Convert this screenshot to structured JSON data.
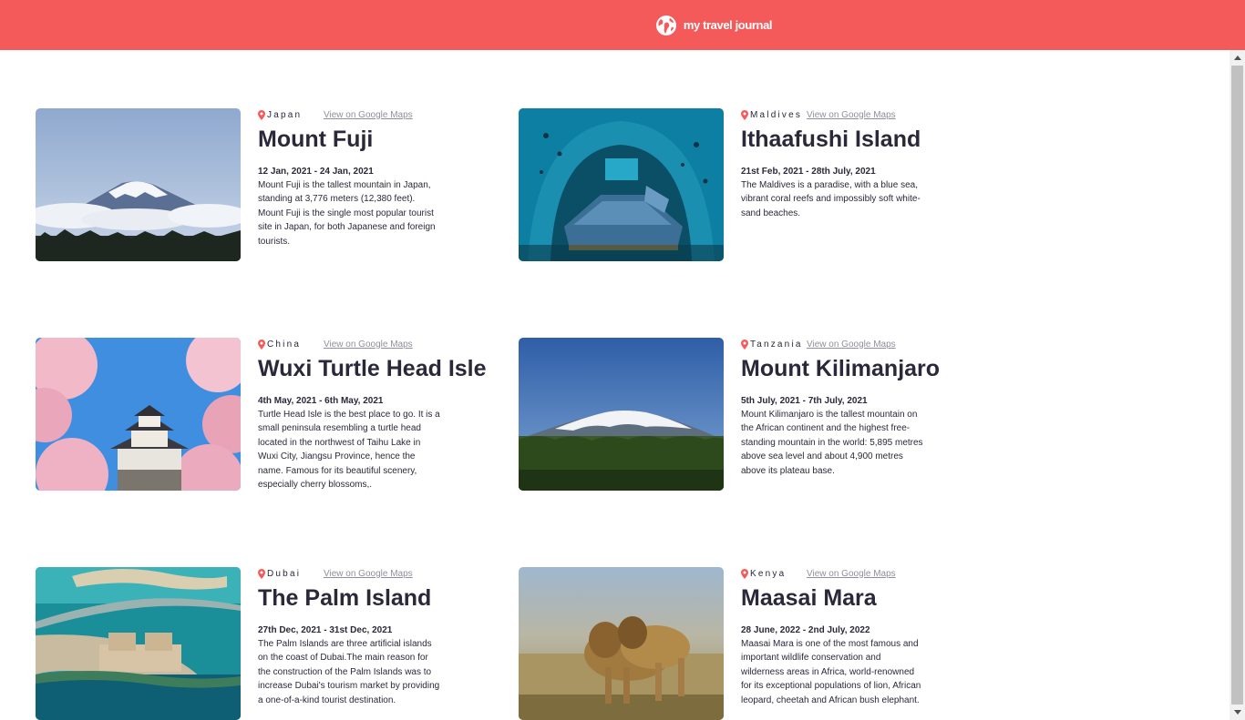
{
  "header": {
    "title": "my travel journal",
    "icon": "globe-icon",
    "background": "#f55a5a"
  },
  "entries": [
    {
      "country": "Japan",
      "maps_label": "View on Google Maps",
      "title": "Mount Fuji",
      "dates": "12 Jan, 2021 - 24 Jan, 2021",
      "description": "Mount Fuji is the tallest mountain in Japan, standing at 3,776 meters (12,380 feet). Mount Fuji is the single most popular tourist site in Japan, for both Japanese and foreign tourists."
    },
    {
      "country": "Maldives",
      "maps_label": "View on Google Maps",
      "title": "Ithaafushi Island",
      "dates": "21st Feb, 2021 - 28th July, 2021",
      "description": "The Maldives is a paradise, with a blue sea, vibrant coral reefs and impossibly soft white-sand beaches."
    },
    {
      "country": "China",
      "maps_label": "View on Google Maps",
      "title": "Wuxi Turtle Head Isle",
      "dates": "4th May, 2021 - 6th May, 2021",
      "description": "Turtle Head Isle is the best place to go. It is a small peninsula resembling a turtle head located in the northwest of Taihu Lake in Wuxi City, Jiangsu Province, hence the name. Famous for its beautiful scenery, especially cherry blossoms,."
    },
    {
      "country": "Tanzania",
      "maps_label": "View on Google Maps",
      "title": "Mount Kilimanjaro",
      "dates": "5th July, 2021 - 7th July, 2021",
      "description": "Mount Kilimanjaro is the tallest mountain on the African continent and the highest free-standing mountain in the world: 5,895 metres above sea level and about 4,900 metres above its plateau base."
    },
    {
      "country": "Dubai",
      "maps_label": "View on Google Maps",
      "title": "The Palm Island",
      "dates": "27th Dec, 2021 - 31st Dec, 2021",
      "description": "The Palm Islands are three artificial islands on the coast of Dubai.The main reason for the construction of the Palm Islands was to increase Dubai's tourism market by providing a one-of-a-kind tourist destination."
    },
    {
      "country": "Kenya",
      "maps_label": "View on Google Maps",
      "title": "Maasai Mara",
      "dates": "28 June, 2022 - 2nd July, 2022",
      "description": "Maasai Mara is one of the most famous and important wildlife conservation and wilderness areas in Africa, world-renowned for its exceptional populations of lion, African leopard, cheetah and African bush elephant."
    }
  ],
  "colors": {
    "accent": "#f55a5a",
    "text": "#2b283a",
    "link": "#918e9b"
  }
}
